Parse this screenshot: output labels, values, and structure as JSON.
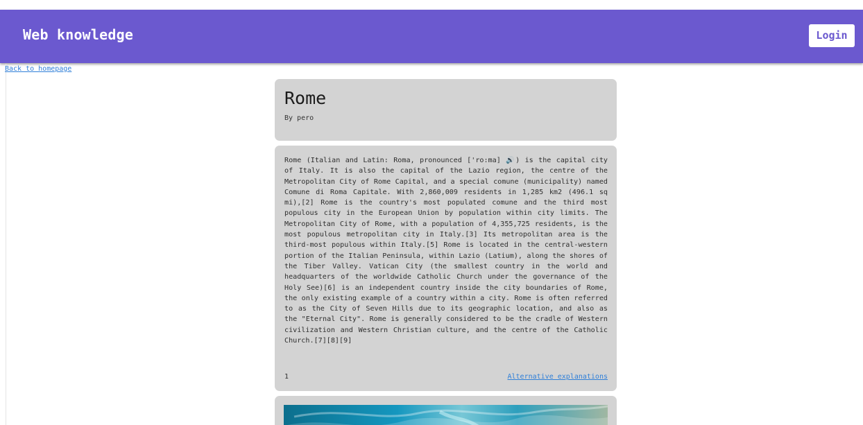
{
  "app": {
    "brand": "Web knowledge",
    "login_label": "Login"
  },
  "navigation": {
    "back_link": "Back to homepage"
  },
  "article": {
    "title": "Rome",
    "author": "By pero",
    "body": "Rome (Italian and Latin: Roma, pronounced ['ro:ma] 🔊) is the capital city of Italy. It is also the capital of the Lazio region, the centre of the Metropolitan City of Rome Capital, and a special comune (municipality) named Comune di Roma Capitale. With 2,860,009 residents in 1,285 km2 (496.1 sq mi),[2] Rome is the country's most populated comune and the third most populous city in the European Union by population within city limits. The Metropolitan City of Rome, with a population of 4,355,725 residents, is the most populous metropolitan city in Italy.[3] Its metropolitan area is the third-most populous within Italy.[5] Rome is located in the central-western portion of the Italian Peninsula, within Lazio (Latium), along the shores of the Tiber Valley. Vatican City (the smallest country in the world and headquarters of the worldwide Catholic Church under the governance of the Holy See)[6] is an independent country inside the city boundaries of Rome, the only existing example of a country within a city. Rome is often referred to as the City of Seven Hills due to its geographic location, and also as the \"Eternal City\". Rome is generally considered to be the cradle of Western civilization and Western Christian culture, and the centre of the Catholic Church.[7][8][9]",
    "count": "1",
    "alternative_link": "Alternative explanations"
  },
  "colors": {
    "header": "#6b59cf",
    "card": "#d3d3d3",
    "link": "#2f7fd8"
  },
  "icons": {
    "audio": "speaker-icon"
  }
}
